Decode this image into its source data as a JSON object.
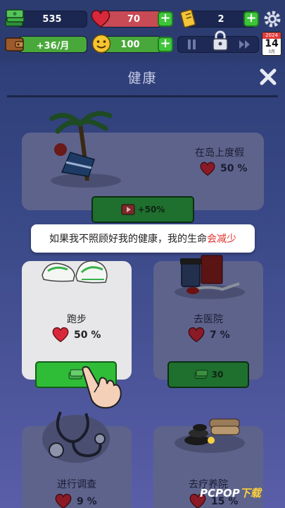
{
  "topbar": {
    "money": "535",
    "health": "70",
    "tickets": "2",
    "income": "+36/月",
    "happiness": "100",
    "calendar_year": "2024",
    "calendar_day": "14",
    "calendar_month": "3月"
  },
  "header": {
    "title": "健康"
  },
  "cards": [
    {
      "title": "在岛上度假",
      "pct": "50 %",
      "button": "+50%"
    },
    {
      "title": "跑步",
      "pct": "50 %"
    },
    {
      "title": "去医院",
      "pct": "7 %",
      "button": "30"
    },
    {
      "title": "进行调查",
      "pct": "9 %"
    },
    {
      "title": "去疗养院",
      "pct": "15 %"
    }
  ],
  "tooltip": {
    "text": "如果我不照顾好我的健康，我的生命",
    "highlight": "会减少"
  },
  "watermark": {
    "main": "PCPOP",
    "tail": "下载"
  },
  "colors": {
    "accent_green": "#2fbd38",
    "heart_red": "#d8283a",
    "bg": "#2c3c70"
  }
}
